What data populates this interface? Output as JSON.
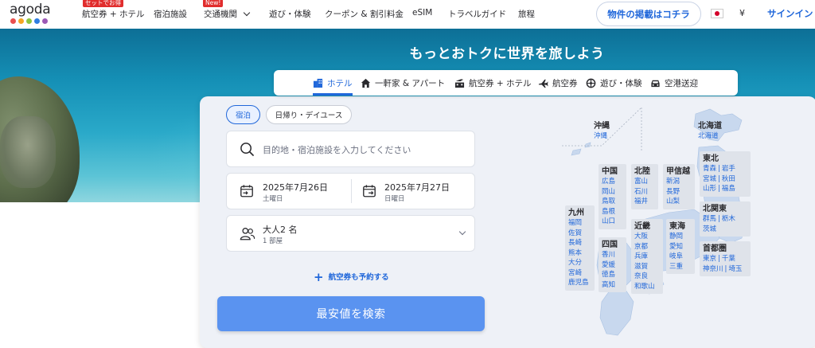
{
  "header": {
    "logo_text": "agoda",
    "logo_dots": [
      "#e94f4f",
      "#f5a623",
      "#8cc63f",
      "#2e7de1",
      "#9b59b6"
    ],
    "nav": [
      {
        "label": "航空券 + ホテル",
        "badge": "セットでお得"
      },
      {
        "label": "宿泊施設",
        "badge": ""
      },
      {
        "label": "交通機関",
        "badge": "New!"
      },
      {
        "label": "遊び・体験",
        "badge": ""
      },
      {
        "label": "クーポン & 割引料金",
        "badge": ""
      },
      {
        "label": "eSIM",
        "badge": ""
      },
      {
        "label": "トラベルガイド",
        "badge": ""
      },
      {
        "label": "旅程",
        "badge": ""
      }
    ],
    "list_property": "物件の掲載はコチラ",
    "currency": "¥",
    "signin": "サインイン"
  },
  "hero": {
    "title": "もっとおトクに世界を旅しよう"
  },
  "tabs": [
    {
      "label": "ホテル",
      "icon": "building-icon",
      "active": true
    },
    {
      "label": "一軒家 & アパート",
      "icon": "house-icon",
      "active": false
    },
    {
      "label": "航空券 + ホテル",
      "icon": "flight-hotel-icon",
      "active": false
    },
    {
      "label": "航空券",
      "icon": "airplane-icon",
      "active": false
    },
    {
      "label": "遊び・体験",
      "icon": "activities-icon",
      "active": false
    },
    {
      "label": "空港送迎",
      "icon": "car-icon",
      "active": false
    }
  ],
  "search": {
    "stay_types": [
      "宿泊",
      "日帰り・デイユース"
    ],
    "destination_placeholder": "目的地・宿泊施設を入力してください",
    "checkin": {
      "date": "2025年7月26日",
      "day": "土曜日"
    },
    "checkout": {
      "date": "2025年7月27日",
      "day": "日曜日"
    },
    "guests": {
      "line1": "大人2 名",
      "line2": "1 部屋"
    },
    "add_flight": "航空券も予約する",
    "search_button": "最安値を検索"
  },
  "map": {
    "regions": [
      {
        "name": "沖縄",
        "prefs": [
          [
            "沖縄"
          ]
        ]
      },
      {
        "name": "北海道",
        "prefs": [
          [
            "北海道"
          ]
        ]
      },
      {
        "name": "中国",
        "prefs": [
          [
            "広島"
          ],
          [
            "岡山"
          ],
          [
            "鳥取"
          ],
          [
            "島根"
          ],
          [
            "山口"
          ]
        ]
      },
      {
        "name": "北陸",
        "prefs": [
          [
            "富山"
          ],
          [
            "石川"
          ],
          [
            "福井"
          ]
        ]
      },
      {
        "name": "甲信越",
        "prefs": [
          [
            "新潟"
          ],
          [
            "長野"
          ],
          [
            "山梨"
          ]
        ]
      },
      {
        "name": "東北",
        "prefs": [
          [
            "青森",
            "岩手"
          ],
          [
            "宮城",
            "秋田"
          ],
          [
            "山形",
            "福島"
          ]
        ]
      },
      {
        "name": "九州",
        "prefs": [
          [
            "福岡"
          ],
          [
            "佐賀"
          ],
          [
            "長崎"
          ],
          [
            "熊本"
          ],
          [
            "大分"
          ],
          [
            "宮崎"
          ],
          [
            "鹿児島"
          ]
        ]
      },
      {
        "name": "近畿",
        "prefs": [
          [
            "大阪"
          ],
          [
            "京都"
          ],
          [
            "兵庫"
          ],
          [
            "滋賀"
          ],
          [
            "奈良"
          ],
          [
            "和歌山"
          ]
        ]
      },
      {
        "name": "東海",
        "prefs": [
          [
            "静岡"
          ],
          [
            "愛知"
          ],
          [
            "岐阜"
          ],
          [
            "三重"
          ]
        ]
      },
      {
        "name": "北関東",
        "prefs": [
          [
            "群馬",
            "栃木"
          ],
          [
            "茨城"
          ]
        ]
      },
      {
        "name": "四国",
        "prefs": [
          [
            "香川"
          ],
          [
            "愛媛"
          ],
          [
            "徳島"
          ],
          [
            "高知"
          ]
        ]
      },
      {
        "name": "首都圏",
        "prefs": [
          [
            "東京",
            "千葉"
          ],
          [
            "神奈川",
            "埼玉"
          ]
        ]
      }
    ]
  },
  "colors": {
    "accent": "#2067da",
    "button": "#5a93f0",
    "badge": "#e12d2d"
  }
}
